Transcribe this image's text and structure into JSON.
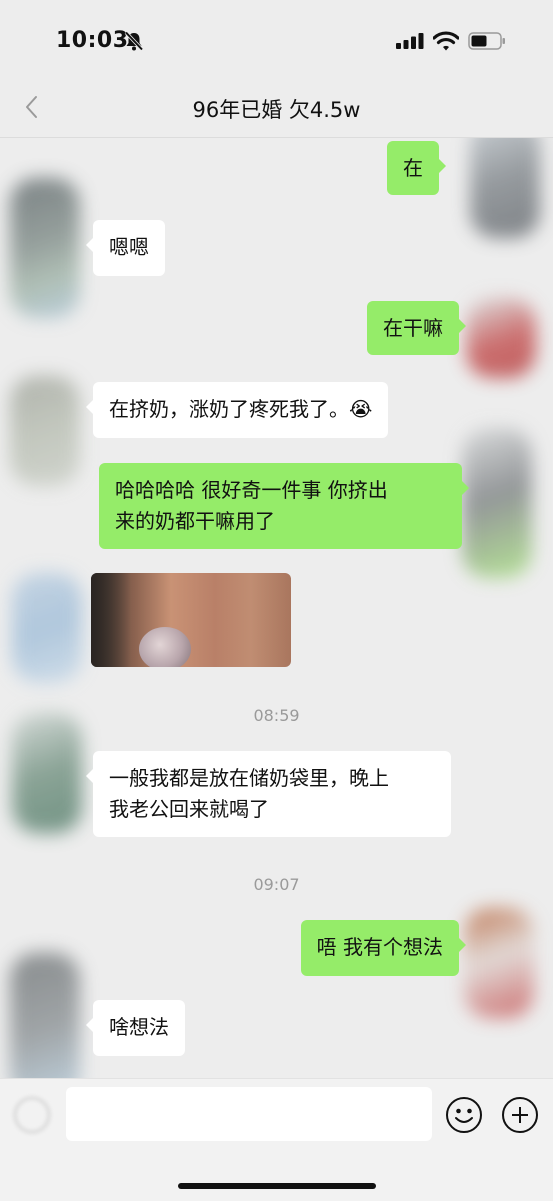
{
  "status_bar": {
    "time": "10:03",
    "icons": [
      "bell-muted-icon",
      "cellular-signal-icon",
      "wifi-icon",
      "battery-icon"
    ]
  },
  "header": {
    "title": "96年已婚 欠4.5w",
    "back_icon": "chevron-left-icon"
  },
  "messages": [
    {
      "side": "out",
      "text": "在"
    },
    {
      "side": "in",
      "text": "嗯嗯"
    },
    {
      "side": "out",
      "text": "在干嘛"
    },
    {
      "side": "in",
      "text": "在挤奶，涨奶了疼死我了。😭"
    },
    {
      "side": "out",
      "text": "哈哈哈哈 很好奇一件事 你挤出\n来的奶都干嘛用了"
    },
    {
      "side": "in",
      "type": "image",
      "text": ""
    },
    {
      "type": "time",
      "text": "08:59"
    },
    {
      "side": "in",
      "text": "一般我都是放在储奶袋里，晚上\n我老公回来就喝了"
    },
    {
      "type": "time",
      "text": "09:07"
    },
    {
      "side": "out",
      "text": "唔 我有个想法"
    },
    {
      "side": "in",
      "text": "啥想法"
    }
  ],
  "input_bar": {
    "voice_icon": "voice-icon",
    "input_value": "",
    "emoji_icon": "emoji-icon",
    "plus_icon": "plus-icon"
  },
  "colors": {
    "background": "#ededed",
    "outgoing_bubble": "#95ec69",
    "incoming_bubble": "#ffffff",
    "timestamp_text": "#9a9a9a"
  }
}
